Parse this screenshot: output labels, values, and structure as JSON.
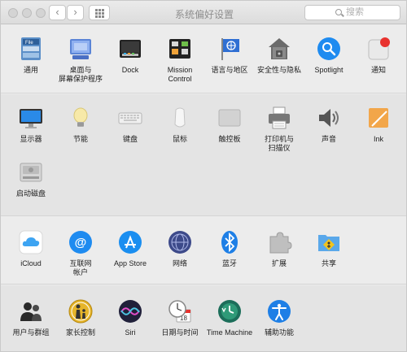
{
  "window": {
    "title": "系统偏好设置",
    "search_placeholder": "搜索",
    "back_label": "‹",
    "forward_label": "›"
  },
  "sections": {
    "row1": [
      {
        "label": "通用",
        "icon": "general-icon"
      },
      {
        "label": "桌面与\n屏幕保护程序",
        "icon": "desktop-icon"
      },
      {
        "label": "Dock",
        "icon": "dock-icon"
      },
      {
        "label": "Mission\nControl",
        "icon": "mission-control-icon"
      },
      {
        "label": "语言与地区",
        "icon": "language-region-icon"
      },
      {
        "label": "安全性与隐私",
        "icon": "security-icon"
      },
      {
        "label": "Spotlight",
        "icon": "spotlight-icon"
      },
      {
        "label": "通知",
        "icon": "notifications-icon"
      }
    ],
    "row2": [
      {
        "label": "显示器",
        "icon": "display-icon"
      },
      {
        "label": "节能",
        "icon": "energy-saver-icon"
      },
      {
        "label": "键盘",
        "icon": "keyboard-icon"
      },
      {
        "label": "鼠标",
        "icon": "mouse-icon"
      },
      {
        "label": "触控板",
        "icon": "trackpad-icon"
      },
      {
        "label": "打印机与\n扫描仪",
        "icon": "printer-icon"
      },
      {
        "label": "声音",
        "icon": "sound-icon"
      },
      {
        "label": "Ink",
        "icon": "ink-icon"
      }
    ],
    "row2b": [
      {
        "label": "启动磁盘",
        "icon": "startup-disk-icon"
      }
    ],
    "row3": [
      {
        "label": "iCloud",
        "icon": "icloud-icon"
      },
      {
        "label": "互联网\n帐户",
        "icon": "internet-accounts-icon"
      },
      {
        "label": "App Store",
        "icon": "app-store-icon"
      },
      {
        "label": "网络",
        "icon": "network-icon"
      },
      {
        "label": "蓝牙",
        "icon": "bluetooth-icon"
      },
      {
        "label": "扩展",
        "icon": "extensions-icon"
      },
      {
        "label": "共享",
        "icon": "sharing-icon"
      }
    ],
    "row4": [
      {
        "label": "用户与群组",
        "icon": "users-groups-icon"
      },
      {
        "label": "家长控制",
        "icon": "parental-controls-icon"
      },
      {
        "label": "Siri",
        "icon": "siri-icon"
      },
      {
        "label": "日期与时间",
        "icon": "date-time-icon"
      },
      {
        "label": "Time Machine",
        "icon": "time-machine-icon"
      },
      {
        "label": "辅助功能",
        "icon": "accessibility-icon"
      }
    ]
  },
  "colors": {
    "accent_blue": "#1e8bf0",
    "notification_red": "#e8322e"
  }
}
